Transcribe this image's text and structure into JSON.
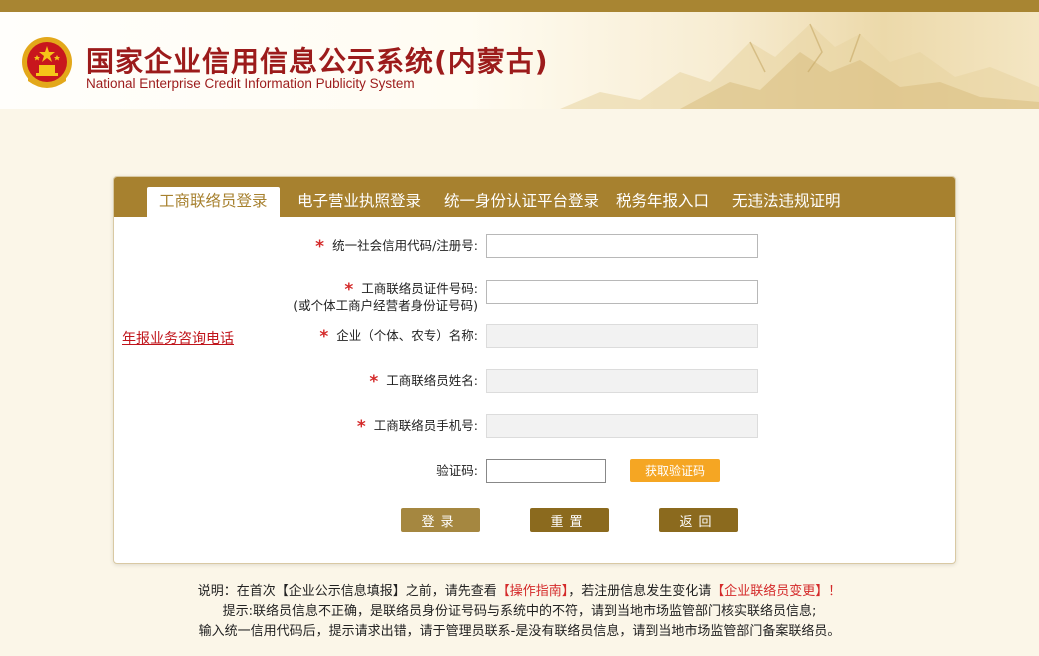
{
  "header": {
    "title": "国家企业信用信息公示系统(内蒙古)",
    "subtitle": "National Enterprise Credit Information Publicity System",
    "emblem_icon": "national-emblem-icon"
  },
  "tabs": [
    {
      "label": "工商联络员登录",
      "active": true
    },
    {
      "label": "电子营业执照登录",
      "active": false
    },
    {
      "label": "统一身份认证平台登录",
      "active": false
    },
    {
      "label": "税务年报入口",
      "active": false
    },
    {
      "label": "无违法违规证明",
      "active": false
    }
  ],
  "side_link": "年报业务咨询电话",
  "form": {
    "credit_code": {
      "label": "统一社会信用代码/注册号:",
      "required": true,
      "value": ""
    },
    "liaison_id": {
      "label": "工商联络员证件号码:",
      "sublabel": "(或个体工商户经营者身份证号码)",
      "required": true,
      "value": ""
    },
    "enterprise_name": {
      "label": "企业（个体、农专）名称:",
      "required": true,
      "value": ""
    },
    "liaison_name": {
      "label": "工商联络员姓名:",
      "required": true,
      "value": ""
    },
    "liaison_phone": {
      "label": "工商联络员手机号:",
      "required": true,
      "value": ""
    },
    "captcha": {
      "label": "验证码:",
      "value": ""
    },
    "get_code_button": "获取验证码"
  },
  "actions": {
    "login": "登录",
    "reset": "重置",
    "back": "返回"
  },
  "notes": {
    "line1_prefix": "说明：在首次【企业公示信息填报】之前，请先查看",
    "line1_link1": "【操作指南】",
    "line1_mid": "，若注册信息发生变化请",
    "line1_link2": "【企业联络员变更】！",
    "line2": "提示:联络员信息不正确，是联络员身份证号码与系统中的不符，请到当地市场监管部门核实联络员信息;",
    "line3": "输入统一信用代码后，提示请求出错，请于管理员联系-是没有联络员信息，请到当地市场监管部门备案联络员。"
  },
  "colors": {
    "brand_red": "#9c1b1b",
    "tab_bar": "#a7812f",
    "button": "#a58740",
    "button_dark": "#8b6a1e",
    "get_code": "#f5a623",
    "required_star": "#d42a2a",
    "page_bg": "#fbf6e8"
  }
}
